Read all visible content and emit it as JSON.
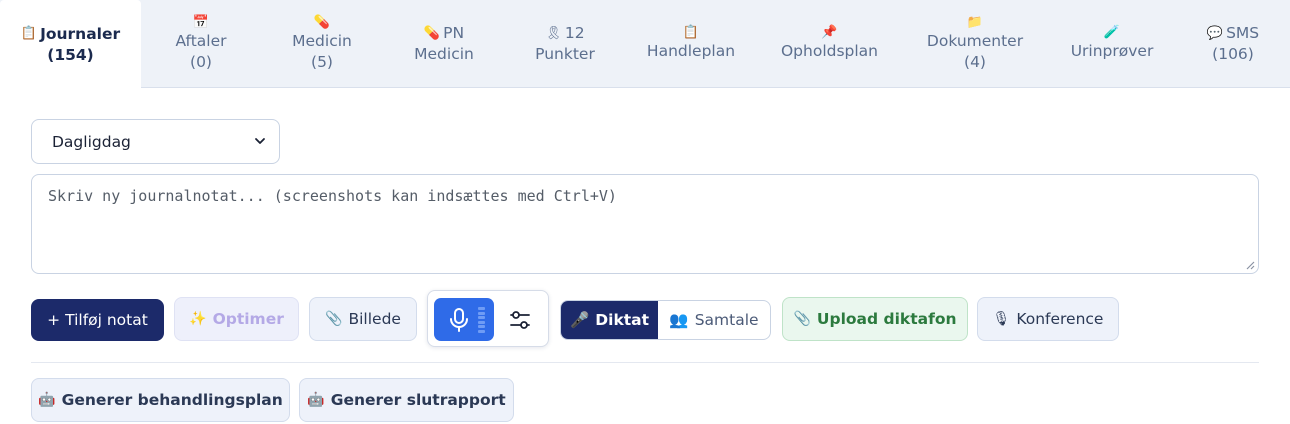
{
  "tabs": [
    {
      "icon": "📋",
      "label": "Journaler",
      "sub": "(154)",
      "active": true
    },
    {
      "icon": "📅",
      "label": "Aftaler",
      "sub": "(0)"
    },
    {
      "icon": "💊",
      "label": "Medicin",
      "sub": "(5)"
    },
    {
      "icon": "💊",
      "label": "PN",
      "sub": "Medicin"
    },
    {
      "icon": "🎗",
      "label": "12",
      "sub": "Punkter"
    },
    {
      "icon": "📋",
      "label": "",
      "sub": "Handleplan"
    },
    {
      "icon": "📌",
      "label": "",
      "sub": "Opholdsplan"
    },
    {
      "icon": "📁",
      "label": "Dokumenter",
      "sub": "(4)"
    },
    {
      "icon": "🧪",
      "label": "",
      "sub": "Urinprøver"
    },
    {
      "icon": "💬",
      "label": "SMS",
      "sub": "(106)"
    }
  ],
  "category_select": {
    "value": "Dagligdag"
  },
  "note": {
    "placeholder": "Skriv ny journalnotat... (screenshots kan indsættes med Ctrl+V)"
  },
  "buttons": {
    "add_note": "+ Tilføj notat",
    "optimize_icon": "✨",
    "optimize": "Optimer",
    "image_icon": "📎",
    "image": "Billede",
    "dictate_icon": "🎤",
    "dictate": "Diktat",
    "conversation_icon": "👥",
    "conversation": "Samtale",
    "upload_icon": "📎",
    "upload": "Upload diktafon",
    "conference_icon": "🎙",
    "conference": "Konference",
    "treatment_plan_icon": "🤖",
    "treatment_plan": "Generer behandlingsplan",
    "final_report_icon": "🤖",
    "final_report": "Generer slutrapport"
  },
  "colors": {
    "primary": "#1c2a6a",
    "mic_blue": "#2f6be8",
    "green_text": "#2c7a3e",
    "tab_bg": "#eef2f8"
  }
}
